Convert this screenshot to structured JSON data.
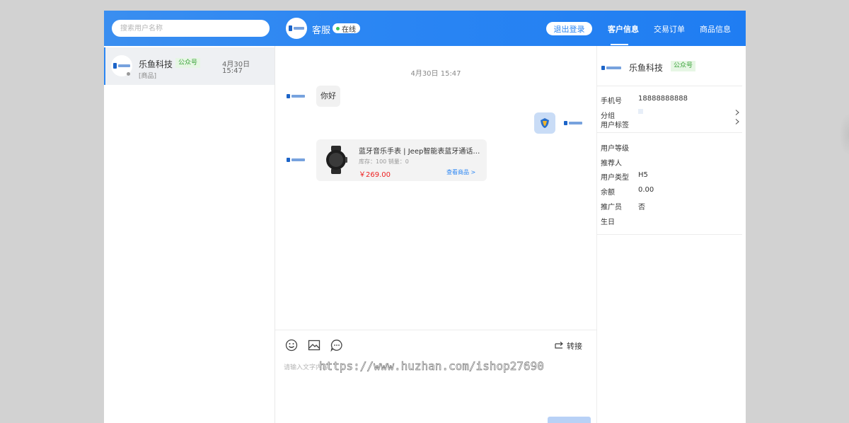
{
  "header": {
    "search_placeholder": "搜索用户名称",
    "agent_name": "客服",
    "status": "在线",
    "logout": "退出登录",
    "tabs": [
      {
        "label": "客户信息",
        "active": true
      },
      {
        "label": "交易订单",
        "active": false
      },
      {
        "label": "商品信息",
        "active": false
      }
    ]
  },
  "brand_logo_text": "乐鱼科技",
  "conversation": {
    "name": "乐鱼科技",
    "tag": "公众号",
    "last_message": "[商品]",
    "date": "4月30日",
    "time": "15:47"
  },
  "chat": {
    "date": "4月30日 15:47",
    "messages": [
      {
        "text": "你好"
      }
    ],
    "product": {
      "title": "蓝牙音乐手表 | Jeep智能表蓝牙通话手表",
      "stock": "库存：100 销量：0",
      "price": "￥269.00",
      "link": "查看商品 >"
    },
    "transfer": "转接",
    "input_placeholder": "请输入文字内容",
    "watermark": "https://www.huzhan.com/ishop27690"
  },
  "customer": {
    "name": "乐鱼科技",
    "tag": "公众号",
    "fields": [
      {
        "label": "手机号",
        "value": "18888888888"
      },
      {
        "label": "分组",
        "value": ""
      },
      {
        "label": "用户标签",
        "value": ""
      },
      {
        "label": "用户等级",
        "value": ""
      },
      {
        "label": "推荐人",
        "value": ""
      },
      {
        "label": "用户类型",
        "value": "H5"
      },
      {
        "label": "余额",
        "value": "0.00"
      },
      {
        "label": "推广员",
        "value": "否"
      },
      {
        "label": "生日",
        "value": ""
      }
    ]
  },
  "colors": {
    "primary": "#2b86f3",
    "online": "#3cc55a",
    "price": "#e22222",
    "tag_bg": "#e6f6e4",
    "tag_text": "#3aa33a"
  }
}
